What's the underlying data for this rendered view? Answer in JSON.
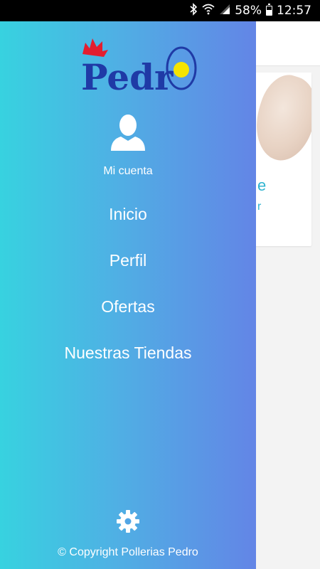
{
  "status_bar": {
    "battery": "58%",
    "time": "12:57",
    "icons": [
      "bluetooth-icon",
      "wifi-icon",
      "signal-icon",
      "battery-icon"
    ],
    "battery_level": 0.58
  },
  "background": {
    "card_title": "e",
    "card_sub": "r"
  },
  "drawer": {
    "logo_text": "Pedr",
    "account_label": "Mi cuenta",
    "menu": [
      {
        "label": "Inicio"
      },
      {
        "label": "Perfil"
      },
      {
        "label": "Ofertas"
      },
      {
        "label": "Nuestras Tiendas"
      }
    ],
    "copyright": "© Copyright Pollerias Pedro"
  },
  "colors": {
    "gradient_start": "#37d2e0",
    "gradient_end": "#6385e6",
    "logo_blue": "#1f3aa6",
    "logo_red": "#e31e2f",
    "logo_yellow": "#f5e400"
  }
}
